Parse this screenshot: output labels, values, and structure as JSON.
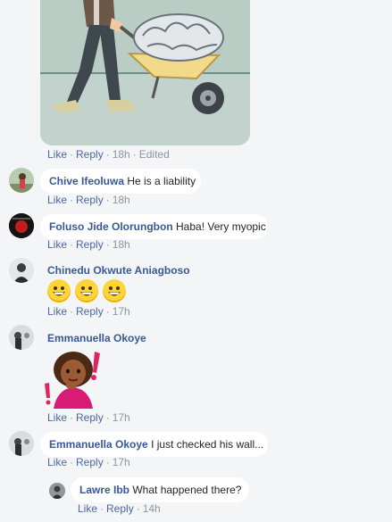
{
  "post_image": {
    "description_icon": "man-pushing-wheelbarrow-with-brain-illustration"
  },
  "image_actions": {
    "like": "Like",
    "reply": "Reply",
    "time": "18h",
    "edited": "Edited"
  },
  "comments": [
    {
      "name": "Chive Ifeoluwa",
      "text": "He is a liability",
      "like": "Like",
      "reply": "Reply",
      "time": "18h"
    },
    {
      "name": "Foluso Jide Olorungbon",
      "text": "Haba! Very myopic",
      "like": "Like",
      "reply": "Reply",
      "time": "18h"
    },
    {
      "name": "Chinedu Okwute Aniagboso",
      "text": "",
      "emoji_icons": [
        "grinning-face-icon",
        "grinning-face-icon",
        "grinning-face-icon"
      ],
      "like": "Like",
      "reply": "Reply",
      "time": "17h"
    },
    {
      "name": "Emmanuella Okoye",
      "text": "",
      "sticker_icon": "thinking-woman-sticker",
      "like": "Like",
      "reply": "Reply",
      "time": "17h"
    },
    {
      "name": "Emmanuella Okoye",
      "text": "I just checked his wall...",
      "like": "Like",
      "reply": "Reply",
      "time": "17h"
    }
  ],
  "reply": {
    "name": "Lawre Ibb",
    "text": "What happened there?",
    "like": "Like",
    "reply": "Reply",
    "time": "14h"
  },
  "colors": {
    "background": "#f4f5f7",
    "bubble": "#ffffff",
    "name": "#385898",
    "link": "#4b67a1",
    "meta": "#8d949e"
  }
}
